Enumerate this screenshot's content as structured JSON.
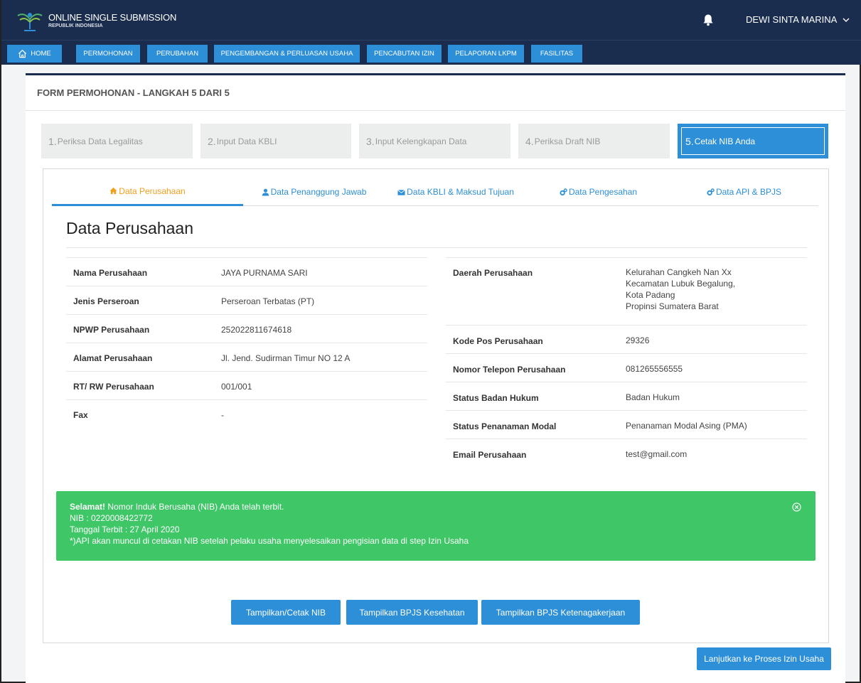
{
  "header": {
    "brand_title": "ONLINE SINGLE SUBMISSION",
    "brand_subtitle": "REPUBLIK INDONESIA",
    "user_name": "DEWI SINTA MARINA"
  },
  "nav": [
    {
      "label": "HOME"
    },
    {
      "label": "PERMOHONAN"
    },
    {
      "label": "PERUBAHAN"
    },
    {
      "label": "PENGEMBANGAN & PERLUASAN USAHA"
    },
    {
      "label": "PENCABUTAN IZIN"
    },
    {
      "label": "PELAPORAN LKPM"
    },
    {
      "label": "FASILITAS"
    }
  ],
  "form_title": "FORM PERMOHONAN - LANGKAH 5 DARI 5",
  "steps": [
    {
      "num": "1.",
      "label": " Periksa Data Legalitas"
    },
    {
      "num": "2.",
      "label": " Input Data KBLI"
    },
    {
      "num": "3.",
      "label": " Input Kelengkapan Data"
    },
    {
      "num": "4.",
      "label": " Periksa Draft NIB"
    },
    {
      "num": "5.",
      "label": " Cetak NIB Anda"
    }
  ],
  "tabs": [
    {
      "label": "Data Perusahaan",
      "icon": "home-icon"
    },
    {
      "label": "Data Penanggung Jawab",
      "icon": "user-icon"
    },
    {
      "label": "Data KBLI & Maksud Tujuan",
      "icon": "envelope-icon"
    },
    {
      "label": "Data Pengesahan",
      "icon": "gears-icon"
    },
    {
      "label": "Data API & BPJS",
      "icon": "gears-icon"
    }
  ],
  "section_title": "Data Perusahaan",
  "left_fields": [
    {
      "key": "Nama Perusahaan",
      "value": "JAYA PURNAMA SARI"
    },
    {
      "key": "Jenis Perseroan",
      "value": "Perseroan Terbatas (PT)"
    },
    {
      "key": "NPWP Perusahaan",
      "value": "252022811674618"
    },
    {
      "key": "Alamat Perusahaan",
      "value": "Jl. Jend. Sudirman Timur NO 12 A"
    },
    {
      "key": "RT/ RW Perusahaan",
      "value": "001/001"
    },
    {
      "key": "Fax",
      "value": "-"
    }
  ],
  "right_fields": [
    {
      "key": "Daerah Perusahaan",
      "lines": [
        "Kelurahan Cangkeh Nan Xx",
        "Kecamatan Lubuk Begalung,",
        "Kota Padang",
        "Propinsi Sumatera Barat"
      ]
    },
    {
      "key": "Kode Pos Perusahaan",
      "value": "29326"
    },
    {
      "key": "Nomor Telepon Perusahaan",
      "value": "081265556555"
    },
    {
      "key": "Status Badan Hukum",
      "value": "Badan Hukum"
    },
    {
      "key": "Status Penanaman Modal",
      "value": "Penanaman Modal Asing (PMA)"
    },
    {
      "key": "Email Perusahaan",
      "value": "test@gmail.com"
    }
  ],
  "alert": {
    "strong": "Selamat!",
    "line1": " Nomor Induk Berusaha (NIB) Anda telah terbit.",
    "line2": "NIB : 0220008422772",
    "line3": "Tanggal Terbit : 27 April 2020",
    "line4": "*)API akan muncul di cetakan NIB setelah pelaku usaha menyelesaikan pengisian data di step Izin Usaha"
  },
  "buttons": {
    "cetak_nib": "Tampilkan/Cetak NIB",
    "bpjs_kesehatan": "Tampilkan BPJS Kesehatan",
    "bpjs_ketenagakerjaan": "Tampilkan BPJS Ketenagakerjaan",
    "lanjutkan": "Lanjutkan ke Proses Izin Usaha"
  },
  "colors": {
    "navy": "#1b2d4f",
    "primary": "#2d8fd8",
    "success": "#3ec667",
    "active_tab": "#f0a020"
  }
}
